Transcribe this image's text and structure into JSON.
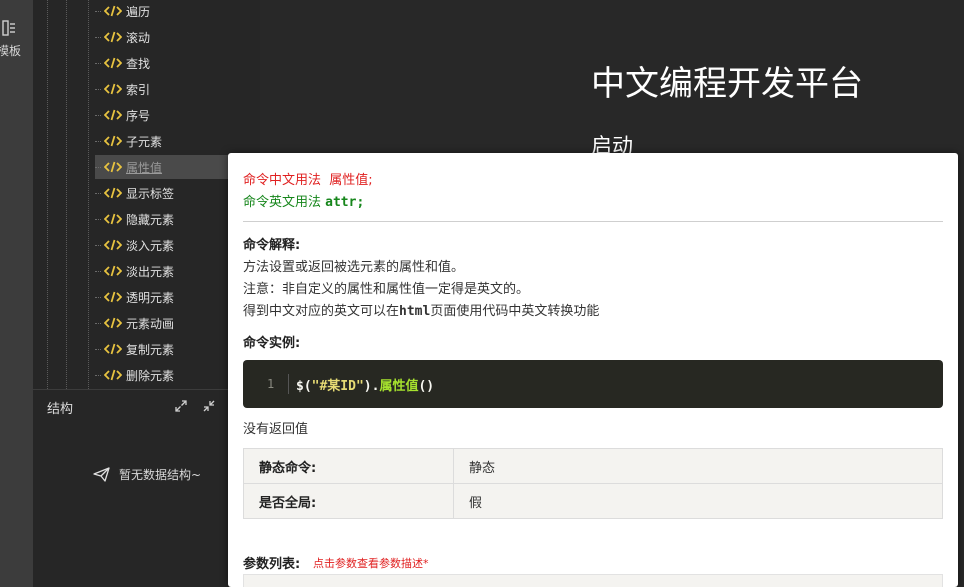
{
  "activity_bar": {
    "template_label": "模板"
  },
  "tree": {
    "items": [
      {
        "label": "遍历"
      },
      {
        "label": "滚动"
      },
      {
        "label": "查找"
      },
      {
        "label": "索引"
      },
      {
        "label": "序号"
      },
      {
        "label": "子元素"
      },
      {
        "label": "属性值",
        "active": true
      },
      {
        "label": "显示标签"
      },
      {
        "label": "隐藏元素"
      },
      {
        "label": "淡入元素"
      },
      {
        "label": "淡出元素"
      },
      {
        "label": "透明元素"
      },
      {
        "label": "元素动画"
      },
      {
        "label": "复制元素"
      },
      {
        "label": "删除元素"
      }
    ]
  },
  "structure": {
    "title": "结构",
    "empty_text": "暂无数据结构~"
  },
  "main": {
    "title": "中文编程开发平台",
    "subtitle": "启动"
  },
  "popup": {
    "usage_cn_prefix": "命令中文用法",
    "usage_cn_code": "属性值;",
    "usage_en_prefix": "命令英文用法",
    "usage_en_code": "attr;",
    "explain_title": "命令解释:",
    "explain_line1": "方法设置或返回被选元素的属性和值。",
    "explain_line2": "注意：非自定义的属性和属性值一定得是英文的。",
    "explain_line3_a": "得到中文对应的英文可以在",
    "explain_line3_mono": "html",
    "explain_line3_b": "页面使用代码中英文转换功能",
    "example_title": "命令实例:",
    "code": {
      "line_number": "1",
      "p1": "$(",
      "str": "\"#某ID\"",
      "p2": ").",
      "fn": "属性值",
      "p3": "()"
    },
    "return_text": "没有返回值",
    "table": [
      {
        "key": "静态命令:",
        "value": "静态"
      },
      {
        "key": "是否全局:",
        "value": "假"
      }
    ],
    "params_title": "参数列表:",
    "params_hint": "点击参数查看参数描述*"
  },
  "colors": {
    "code_icon": "#e8c340",
    "usage_cn": "#e02020",
    "usage_en": "#16861b",
    "code_bg": "#272822"
  }
}
